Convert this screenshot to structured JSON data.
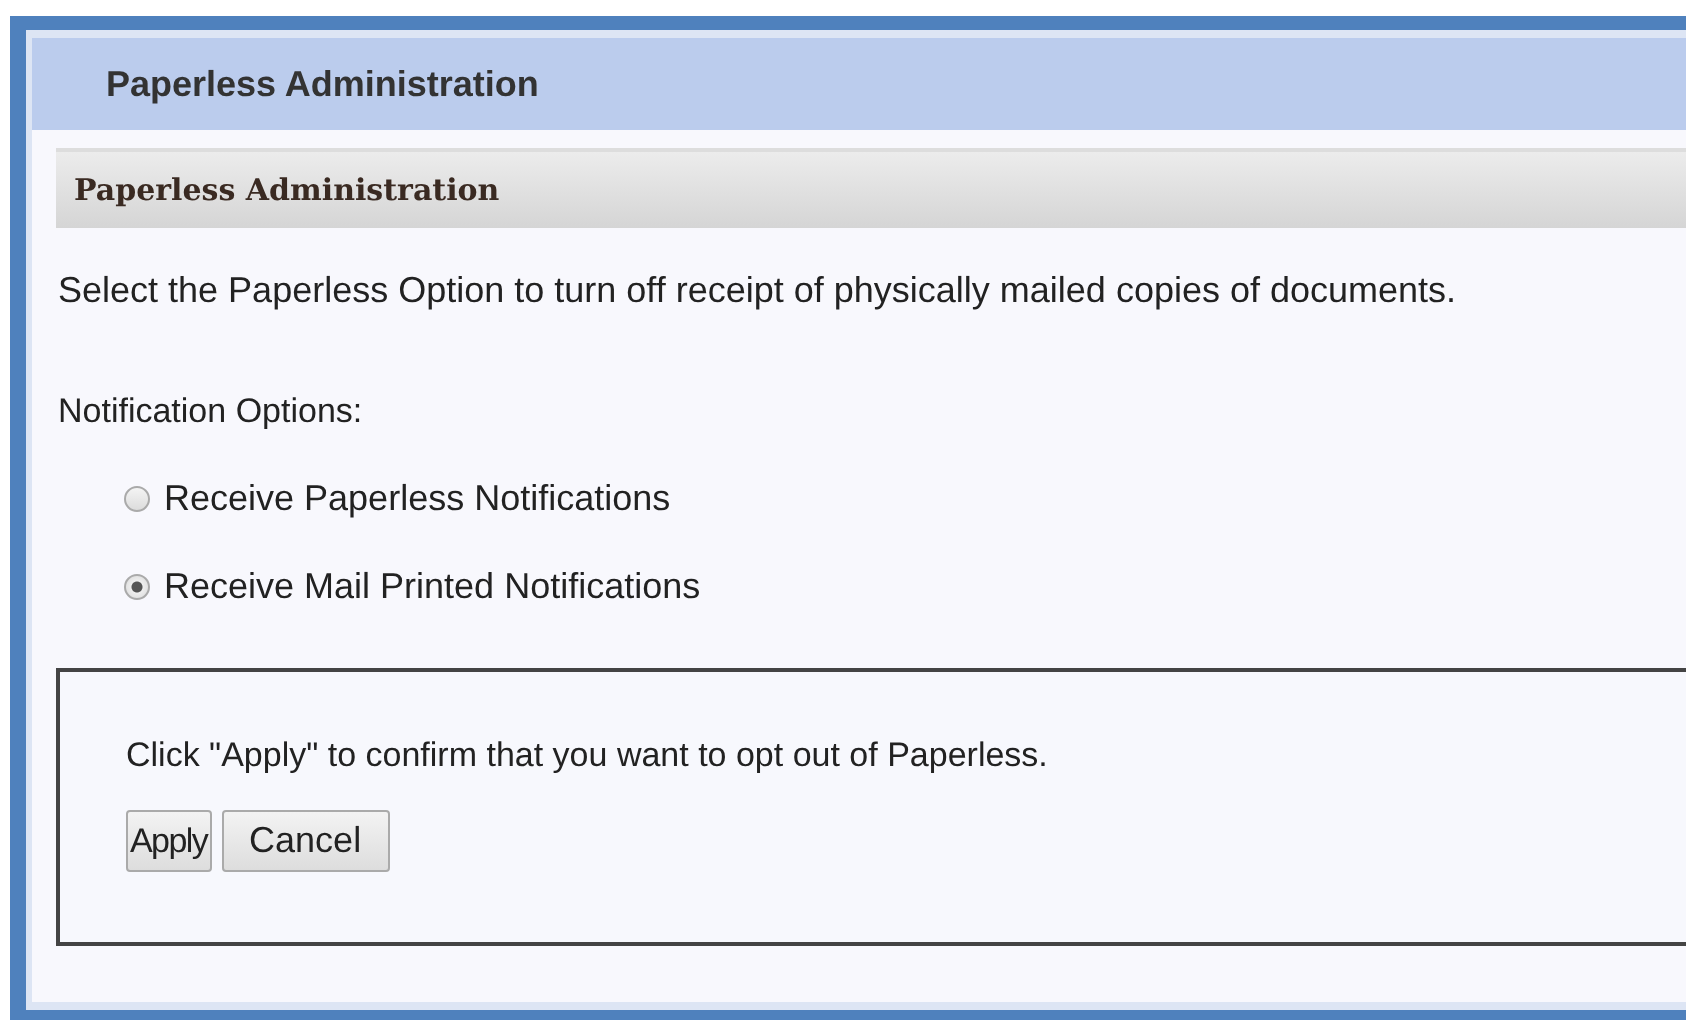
{
  "panel": {
    "title": "Paperless Administration"
  },
  "section": {
    "title": "Paperless Administration",
    "description": "Select the Paperless Option to turn off receipt of physically mailed copies of documents.",
    "options_label": "Notification Options:",
    "options": [
      {
        "label": "Receive Paperless Notifications",
        "selected": false
      },
      {
        "label": "Receive Mail Printed Notifications",
        "selected": true
      }
    ]
  },
  "confirm": {
    "message": "Click \"Apply\" to confirm that you want to opt out of Paperless.",
    "buttons": [
      "Apply",
      "Cancel"
    ]
  }
}
